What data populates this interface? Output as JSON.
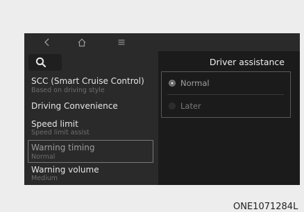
{
  "topbar": {
    "back_icon": "chevron-left-icon",
    "home_icon": "home-icon",
    "menu_icon": "hamburger-menu-icon"
  },
  "search": {
    "icon": "search-icon"
  },
  "menu": {
    "items": [
      {
        "title": "SCC (Smart Cruise Control)",
        "subtitle": "Based on driving style"
      },
      {
        "title": "Driving Convenience",
        "subtitle": ""
      },
      {
        "title": "Speed limit",
        "subtitle": "Speed limit assist"
      },
      {
        "title": "Warning timing",
        "subtitle": "Normal",
        "selected": true
      },
      {
        "title": "Warning volume",
        "subtitle": "Medium"
      }
    ]
  },
  "panel": {
    "title": "Driver assistance",
    "options": [
      {
        "label": "Normal",
        "checked": true
      },
      {
        "label": "Later",
        "checked": false
      }
    ]
  },
  "figure_code": "ONE1071284L",
  "colors": {
    "background": "#ededed",
    "screen": "#1b1b1b",
    "pane": "#2a2a2a"
  }
}
